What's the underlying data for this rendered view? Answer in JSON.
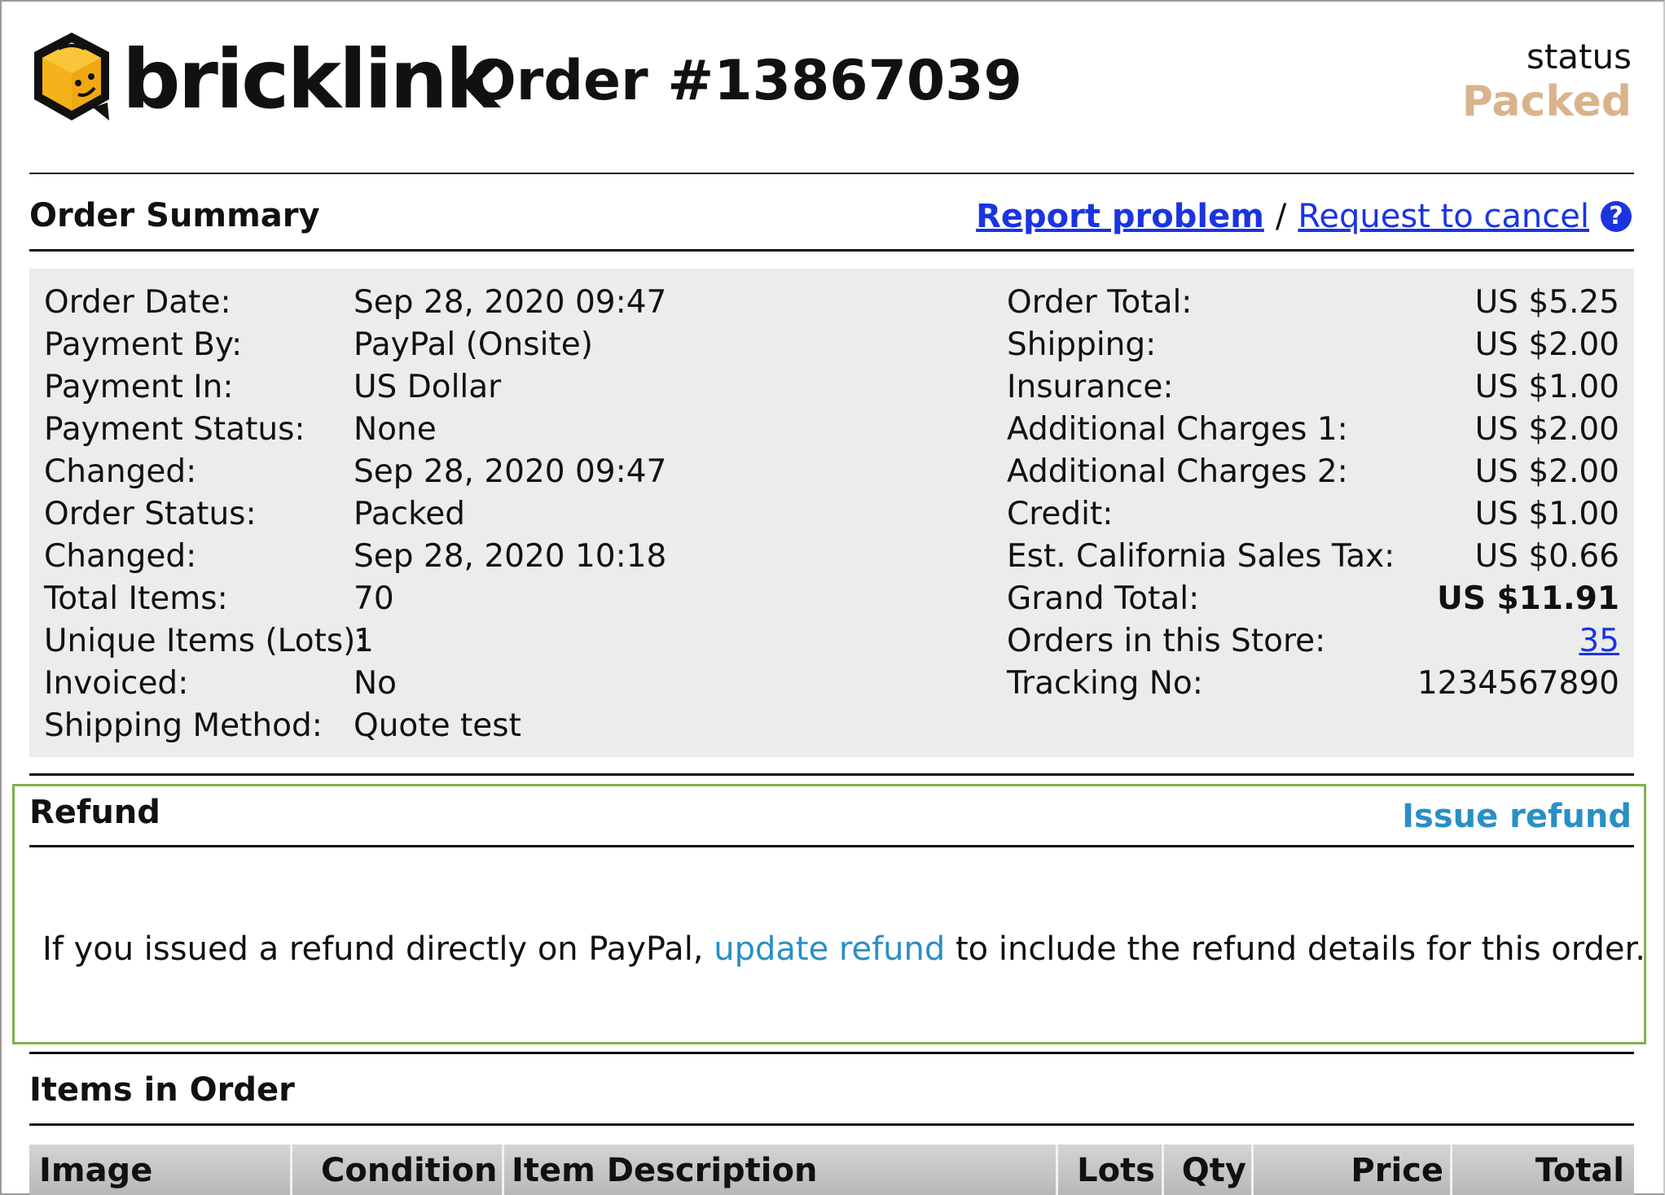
{
  "brand": {
    "name": "bricklink",
    "logo_icon": "bricklink-cube-logo"
  },
  "order": {
    "title": "Order #13867039",
    "status_label": "status",
    "status_value": "Packed"
  },
  "summary": {
    "title": "Order Summary",
    "report_problem": "Report problem",
    "separator": "/",
    "request_cancel": "Request to cancel",
    "help_icon": "?",
    "left": [
      {
        "label": "Order Date:",
        "value": "Sep 28, 2020 09:47"
      },
      {
        "label": "Payment By:",
        "value": "PayPal (Onsite)"
      },
      {
        "label": "Payment In:",
        "value": "US Dollar"
      },
      {
        "label": "Payment Status:",
        "value": "None"
      },
      {
        "label": "Changed:",
        "value": "Sep 28, 2020 09:47"
      },
      {
        "label": "Order Status:",
        "value": "Packed"
      },
      {
        "label": "Changed:",
        "value": "Sep 28, 2020 10:18"
      },
      {
        "label": "Total Items:",
        "value": "70"
      },
      {
        "label": "Unique Items (Lots):",
        "value": "1"
      },
      {
        "label": "Invoiced:",
        "value": "No"
      },
      {
        "label": "Shipping Method:",
        "value": "Quote test"
      }
    ],
    "right": [
      {
        "label": "Order Total:",
        "value": "US $5.25"
      },
      {
        "label": "Shipping:",
        "value": "US $2.00"
      },
      {
        "label": "Insurance:",
        "value": "US $1.00"
      },
      {
        "label": "Additional Charges 1:",
        "value": "US $2.00"
      },
      {
        "label": "Additional Charges 2:",
        "value": "US $2.00"
      },
      {
        "label": "Credit:",
        "value": "US $1.00"
      },
      {
        "label": "Est. California Sales Tax:",
        "value": "US $0.66"
      },
      {
        "label": "Grand Total:",
        "value": "US $11.91"
      },
      {
        "label": "Orders in this Store:",
        "value": "35"
      },
      {
        "label": "Tracking No:",
        "value": "1234567890"
      }
    ]
  },
  "refund": {
    "title": "Refund",
    "issue_refund": "Issue refund",
    "text_before": "If you issued a refund directly on PayPal, ",
    "update_link": "update refund",
    "text_after": " to include the refund details for this order."
  },
  "items": {
    "title": "Items in Order",
    "columns": [
      "Image",
      "Condition",
      "Item Description",
      "Lots",
      "Qty",
      "Price",
      "Total"
    ]
  }
}
